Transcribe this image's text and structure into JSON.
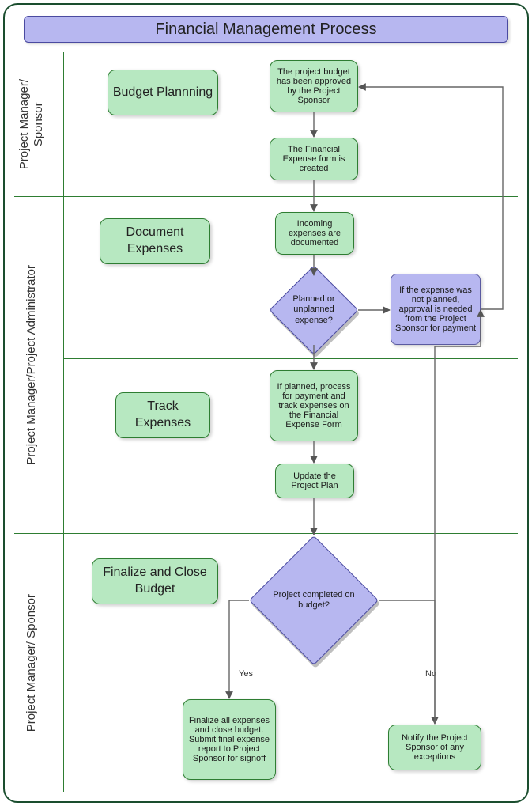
{
  "title": "Financial Management Process",
  "lanes": {
    "l1": "Project Manager/\nSponsor",
    "l2": "Project Manager/Project Administrator",
    "l3": "Project Manager/ Sponsor"
  },
  "phases": {
    "p1": "Budget Plannning",
    "p2": "Document Expenses",
    "p3": "Track Expenses",
    "p4": "Finalize and Close Budget"
  },
  "nodes": {
    "n1": "The project budget has been approved by the Project Sponsor",
    "n2": "The Financial Expense form is created",
    "n3": "Incoming expenses are documented",
    "d1": "Planned or unplanned expense?",
    "side1": "If the expense was not planned, approval is needed from the Project Sponsor for payment",
    "n4": "If planned, process for payment and track expenses on the Financial Expense Form",
    "n5": "Update the Project Plan",
    "d2": "Project completed on budget?",
    "n6": "Finalize all expenses and close budget. Submit final expense report to Project Sponsor for signoff",
    "n7": "Notify the Project Sponsor of any exceptions"
  },
  "labels": {
    "yes": "Yes",
    "no": "No"
  }
}
